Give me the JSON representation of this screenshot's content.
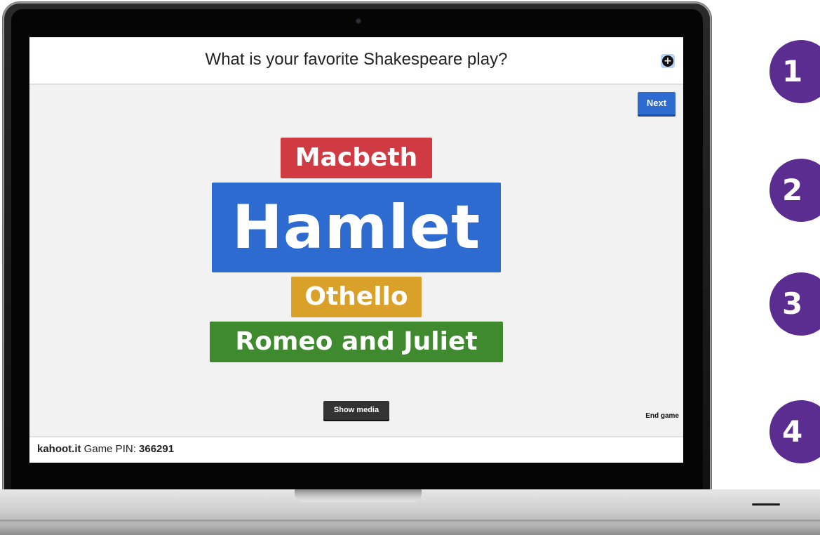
{
  "quiz": {
    "question": "What is your favorite Shakespeare play?",
    "next_label": "Next",
    "show_media_label": "Show media",
    "end_game_label": "End game",
    "add_icon": "plus-circle-icon"
  },
  "word_cloud": {
    "items": [
      {
        "label": "Macbeth",
        "color": "#cf3a43"
      },
      {
        "label": "Hamlet",
        "color": "#2d6bd0"
      },
      {
        "label": "Othello",
        "color": "#d9a02a"
      },
      {
        "label": "Romeo and Juliet",
        "color": "#3f8a2e"
      }
    ]
  },
  "footer": {
    "site": "kahoot.it",
    "pin_label": "Game PIN:",
    "pin": "366291"
  },
  "badges": [
    "1",
    "2",
    "3",
    "4"
  ],
  "colors": {
    "accent": "#2d6bd0",
    "badge": "#5c2d91"
  }
}
